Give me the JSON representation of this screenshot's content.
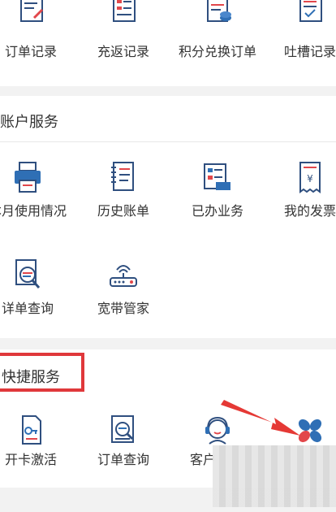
{
  "orders": {
    "items": [
      {
        "label": "订单记录",
        "icon": "order-record-icon"
      },
      {
        "label": "充返记录",
        "icon": "recharge-record-icon"
      },
      {
        "label": "积分兑换订单",
        "icon": "points-exchange-icon"
      },
      {
        "label": "吐槽记录",
        "icon": "complaint-record-icon"
      }
    ]
  },
  "account": {
    "title": "账户服务",
    "row1": [
      {
        "label": "本月使用情况",
        "icon": "printer-icon"
      },
      {
        "label": "历史账单",
        "icon": "notebook-icon"
      },
      {
        "label": "已办业务",
        "icon": "business-card-icon"
      },
      {
        "label": "我的发票",
        "icon": "invoice-icon"
      }
    ],
    "row2": [
      {
        "label": "详单查询",
        "icon": "search-detail-icon"
      },
      {
        "label": "宽带管家",
        "icon": "router-icon"
      }
    ]
  },
  "quick": {
    "title": "快捷服务",
    "items": [
      {
        "label": "开卡激活",
        "icon": "sim-card-key-icon"
      },
      {
        "label": "订单查询",
        "icon": "order-search-icon"
      },
      {
        "label": "客户",
        "icon": "customer-service-icon"
      },
      {
        "label": "",
        "icon": "more-petals-icon"
      }
    ]
  },
  "colors": {
    "highlight_box": "#e0383b",
    "arrow": "#e53935",
    "icon_blue": "#2f6fb5",
    "icon_red": "#e2474b"
  }
}
